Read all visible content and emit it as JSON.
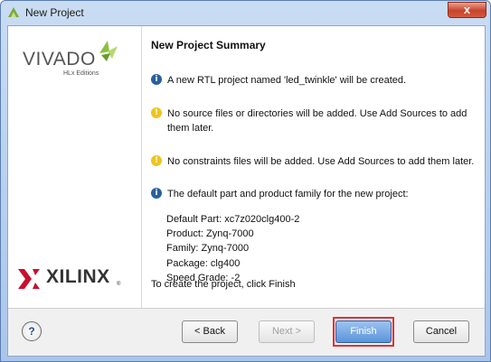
{
  "window": {
    "title": "New Project",
    "close_glyph": "x"
  },
  "sidebar": {
    "vivado_logo_text": "VIVADO",
    "vivado_edition": "HLx Editions",
    "xilinx_logo_text": "XILINX",
    "xilinx_reg": "®"
  },
  "summary": {
    "heading": "New Project Summary",
    "messages": [
      {
        "kind": "info-icon",
        "text": "A new RTL project named 'led_twinkle' will be created."
      },
      {
        "kind": "warning-icon",
        "text": "No source files or directories will be added. Use Add Sources to add them later."
      },
      {
        "kind": "warning-icon",
        "text": "No constraints files will be added. Use Add Sources to add them later."
      },
      {
        "kind": "info-icon",
        "text": "The default part and product family for the new project:"
      }
    ],
    "part_details": [
      "Default Part: xc7z020clg400-2",
      "Product: Zynq-7000",
      "Family: Zynq-7000",
      "Package: clg400",
      "Speed Grade: -2"
    ],
    "finish_note": "To create the project, click Finish"
  },
  "footer": {
    "help_glyph": "?",
    "back_label": "< Back",
    "next_label": "Next >",
    "finish_label": "Finish",
    "cancel_label": "Cancel"
  },
  "colors": {
    "info_icon": "#2a5f9e",
    "warning_icon": "#f0c419",
    "highlight_frame": "#e0303a",
    "primary_button": "#5b94db"
  }
}
